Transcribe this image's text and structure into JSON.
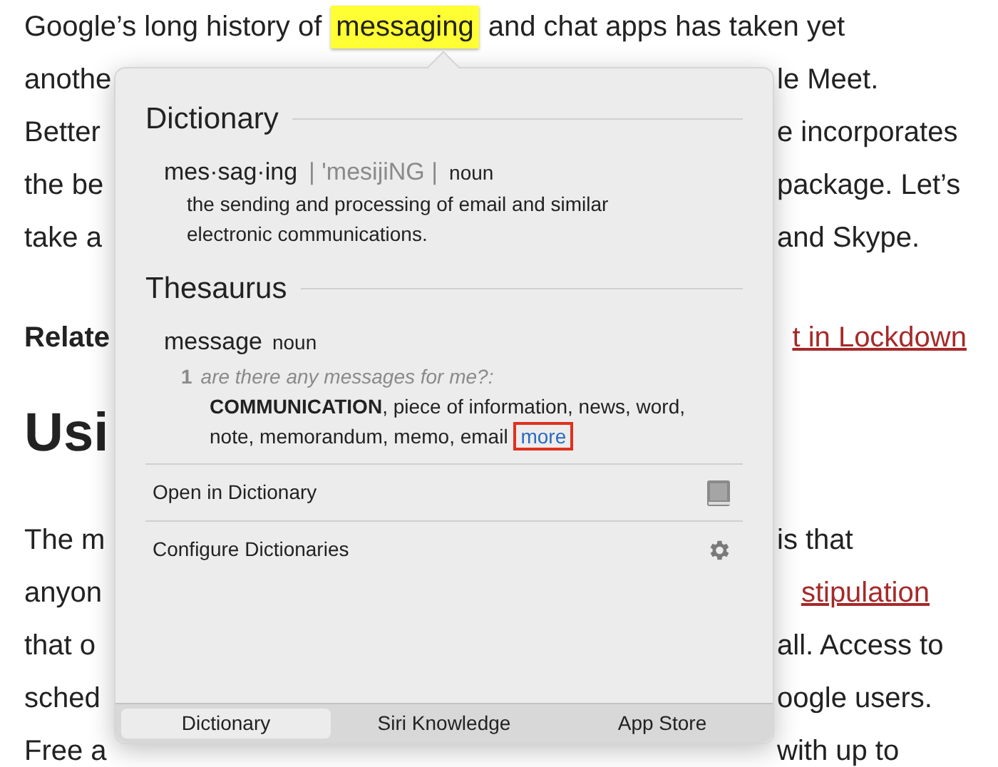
{
  "article": {
    "first_line": {
      "before": "Google’s long history of",
      "highlight": "messaging",
      "after": "and chat apps has taken yet"
    },
    "lines": [
      {
        "kind": "body",
        "left": "anothe",
        "right": "le Meet."
      },
      {
        "kind": "body",
        "left": "Better",
        "right": "e incorporates"
      },
      {
        "kind": "body",
        "left": "the be",
        "right": "package. Let’s"
      },
      {
        "kind": "body",
        "left": "take a",
        "right": "and Skype."
      },
      {
        "kind": "related",
        "left": "Relate",
        "right": "t in Lockdown"
      },
      {
        "kind": "heading",
        "left": "Usi"
      },
      {
        "kind": "body",
        "left": "The m",
        "right": "is that"
      },
      {
        "kind": "link",
        "left": "anyon",
        "right": "stipulation"
      },
      {
        "kind": "body",
        "left": "that o",
        "right": "all. Access to"
      },
      {
        "kind": "body",
        "left": "sched",
        "right": "oogle users."
      },
      {
        "kind": "body",
        "left": "Free a",
        "right": "with up to"
      }
    ]
  },
  "popover": {
    "dictionary": {
      "title": "Dictionary",
      "headword": "mes·sag·ing",
      "pronunciation": "| 'mesijiNG |",
      "part_of_speech": "noun",
      "definition": "the sending and processing of email and similar electronic communications."
    },
    "thesaurus": {
      "title": "Thesaurus",
      "headword": "message",
      "part_of_speech": "noun",
      "sense_number": "1",
      "example": "are there any messages for me?:",
      "synonyms": "**COMMUNICATION**, piece of information, news, word, note, memorandum, memo, email",
      "more_link": "more",
      "more_highlighted": true
    },
    "actions": [
      {
        "label": "Open in Dictionary",
        "kind": "book"
      },
      {
        "label": "Configure Dictionaries",
        "kind": "gear"
      }
    ],
    "tabs": [
      {
        "label": "Dictionary",
        "selected": true
      },
      {
        "label": "Siri Knowledge",
        "selected": false
      },
      {
        "label": "App Store",
        "selected": false
      }
    ]
  }
}
